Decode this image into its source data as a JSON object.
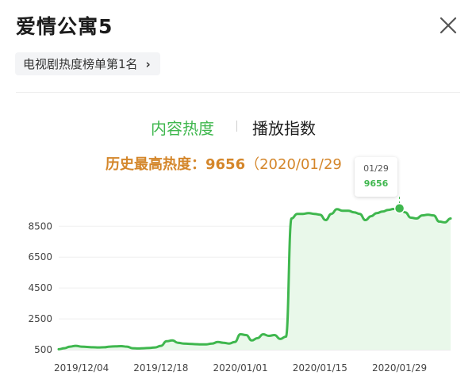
{
  "header": {
    "title": "爱情公寓5",
    "close_icon": "close-icon"
  },
  "rank_chip": {
    "label": "电视剧热度榜单第1名",
    "chevron": "›"
  },
  "tabs": [
    {
      "label": "内容热度",
      "active": true
    },
    {
      "label": "播放指数",
      "active": false
    }
  ],
  "peak": {
    "label": "历史最高热度：",
    "value": "9656",
    "date": "（2020/01/29"
  },
  "tooltip": {
    "date": "01/29",
    "value": "9656"
  },
  "colors": {
    "accent": "#3fb74e",
    "peak_text": "#d4862a",
    "area_fill": "#e9f8ea"
  },
  "chart_data": {
    "type": "area",
    "y_ticks": [
      500,
      2500,
      4500,
      6500,
      8500
    ],
    "x_tick_labels": [
      "2019/12/04",
      "2019/12/18",
      "2020/01/01",
      "2020/01/15",
      "2020/01/29"
    ],
    "x_tick_dates": [
      "2019-12-04",
      "2019-12-18",
      "2020-01-01",
      "2020-01-15",
      "2020-01-29"
    ],
    "xlim": [
      "2019-11-30",
      "2020-02-07"
    ],
    "ylim": [
      500,
      9900
    ],
    "highlight": {
      "date": "2020-01-29",
      "value": 9656
    },
    "points": [
      [
        "2019-11-30",
        530
      ],
      [
        "2019-12-01",
        600
      ],
      [
        "2019-12-02",
        700
      ],
      [
        "2019-12-03",
        750
      ],
      [
        "2019-12-04",
        700
      ],
      [
        "2019-12-05",
        680
      ],
      [
        "2019-12-06",
        660
      ],
      [
        "2019-12-07",
        650
      ],
      [
        "2019-12-08",
        660
      ],
      [
        "2019-12-09",
        700
      ],
      [
        "2019-12-10",
        720
      ],
      [
        "2019-12-11",
        730
      ],
      [
        "2019-12-12",
        700
      ],
      [
        "2019-12-13",
        600
      ],
      [
        "2019-12-14",
        580
      ],
      [
        "2019-12-15",
        600
      ],
      [
        "2019-12-16",
        620
      ],
      [
        "2019-12-17",
        650
      ],
      [
        "2019-12-18",
        750
      ],
      [
        "2019-12-19",
        1050
      ],
      [
        "2019-12-20",
        1100
      ],
      [
        "2019-12-21",
        950
      ],
      [
        "2019-12-22",
        900
      ],
      [
        "2019-12-23",
        880
      ],
      [
        "2019-12-24",
        860
      ],
      [
        "2019-12-25",
        850
      ],
      [
        "2019-12-26",
        850
      ],
      [
        "2019-12-27",
        900
      ],
      [
        "2019-12-28",
        1000
      ],
      [
        "2019-12-29",
        950
      ],
      [
        "2019-12-30",
        900
      ],
      [
        "2019-12-31",
        1000
      ],
      [
        "2020-01-01",
        1500
      ],
      [
        "2020-01-02",
        1450
      ],
      [
        "2020-01-03",
        1100
      ],
      [
        "2020-01-04",
        1250
      ],
      [
        "2020-01-05",
        1500
      ],
      [
        "2020-01-06",
        1400
      ],
      [
        "2020-01-07",
        1450
      ],
      [
        "2020-01-08",
        1200
      ],
      [
        "2020-01-09",
        1350
      ],
      [
        "2020-01-10",
        9000
      ],
      [
        "2020-01-11",
        9300
      ],
      [
        "2020-01-12",
        9300
      ],
      [
        "2020-01-13",
        9350
      ],
      [
        "2020-01-14",
        9300
      ],
      [
        "2020-01-15",
        9250
      ],
      [
        "2020-01-16",
        8900
      ],
      [
        "2020-01-17",
        9300
      ],
      [
        "2020-01-18",
        9600
      ],
      [
        "2020-01-19",
        9500
      ],
      [
        "2020-01-20",
        9500
      ],
      [
        "2020-01-21",
        9400
      ],
      [
        "2020-01-22",
        9300
      ],
      [
        "2020-01-23",
        8900
      ],
      [
        "2020-01-24",
        9150
      ],
      [
        "2020-01-25",
        9350
      ],
      [
        "2020-01-26",
        9450
      ],
      [
        "2020-01-27",
        9550
      ],
      [
        "2020-01-28",
        9620
      ],
      [
        "2020-01-29",
        9656
      ],
      [
        "2020-01-30",
        9400
      ],
      [
        "2020-01-31",
        9050
      ],
      [
        "2020-02-01",
        9000
      ],
      [
        "2020-02-02",
        9200
      ],
      [
        "2020-02-03",
        9250
      ],
      [
        "2020-02-04",
        9200
      ],
      [
        "2020-02-05",
        8800
      ],
      [
        "2020-02-06",
        8750
      ],
      [
        "2020-02-07",
        9000
      ]
    ]
  }
}
